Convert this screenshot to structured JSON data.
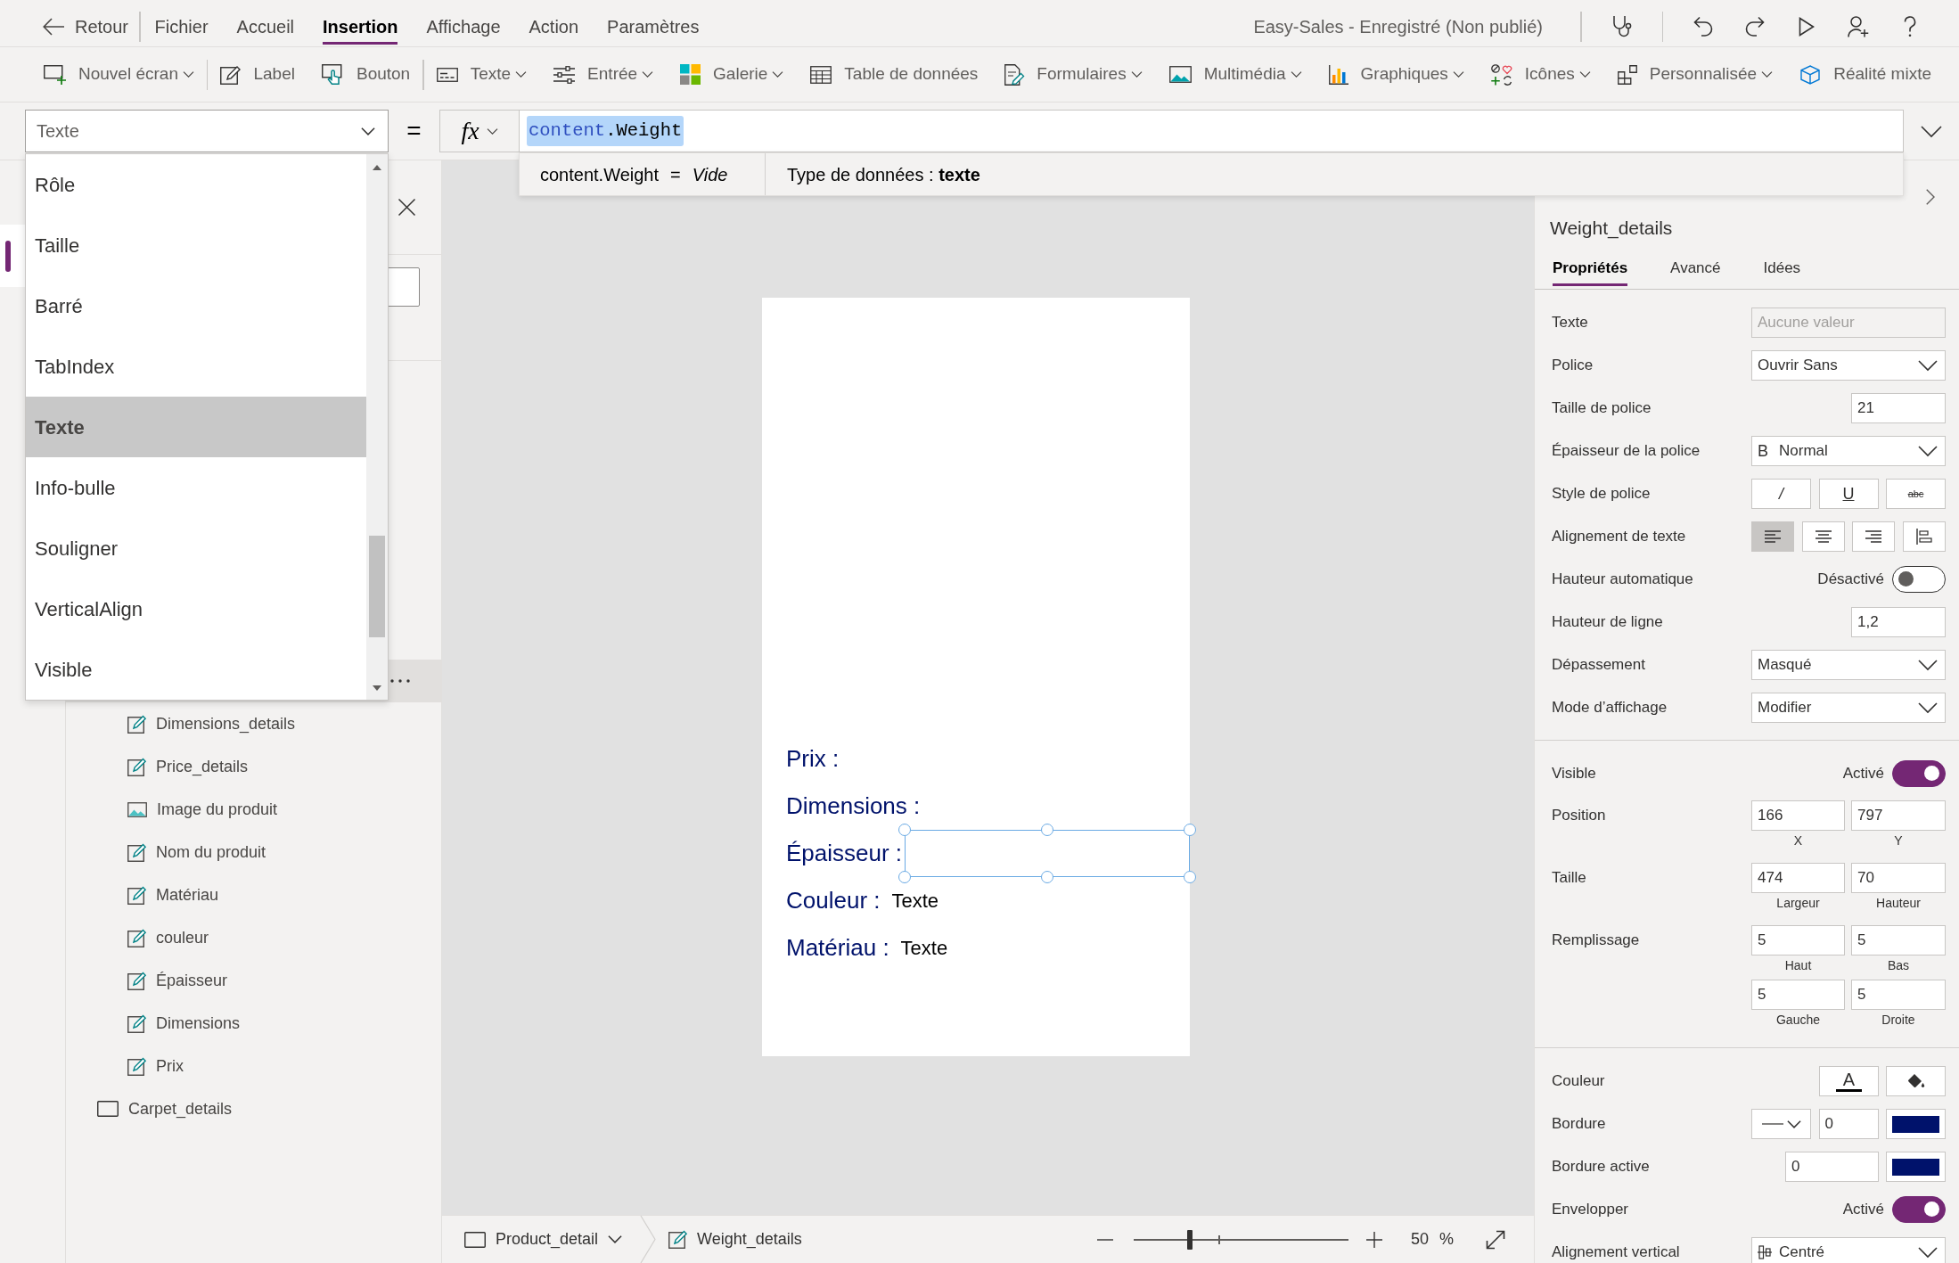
{
  "top_bar": {
    "back": "Retour",
    "menu": [
      {
        "label": "Fichier",
        "selected": false
      },
      {
        "label": "Accueil",
        "selected": false
      },
      {
        "label": "Insertion",
        "selected": true
      },
      {
        "label": "Affichage",
        "selected": false
      },
      {
        "label": "Action",
        "selected": false
      },
      {
        "label": "Paramètres",
        "selected": false
      }
    ],
    "app_status": "Easy-Sales - Enregistré (Non publié)",
    "action_groups": [
      [
        {
          "kind": "checker"
        }
      ],
      [
        {
          "kind": "undo"
        },
        {
          "kind": "redo"
        },
        {
          "kind": "preview"
        },
        {
          "kind": "share"
        },
        {
          "kind": "help"
        }
      ]
    ]
  },
  "ribbon": {
    "groups": [
      [
        {
          "kind": "new_screen",
          "label": "Nouvel écran",
          "dropdown": true
        }
      ],
      [
        {
          "kind": "label",
          "label": "Label",
          "dropdown": false
        },
        {
          "kind": "button",
          "label": "Bouton",
          "dropdown": false
        }
      ],
      [
        {
          "kind": "text",
          "label": "Texte",
          "dropdown": true
        },
        {
          "kind": "input",
          "label": "Entrée",
          "dropdown": true
        },
        {
          "kind": "gallery",
          "label": "Galerie",
          "dropdown": true
        },
        {
          "kind": "table",
          "label": "Table de données",
          "dropdown": false
        },
        {
          "kind": "forms",
          "label": "Formulaires",
          "dropdown": true
        },
        {
          "kind": "media",
          "label": "Multimédia",
          "dropdown": true
        },
        {
          "kind": "charts",
          "label": "Graphiques",
          "dropdown": true
        },
        {
          "kind": "icons",
          "label": "Icônes",
          "dropdown": true
        },
        {
          "kind": "custom",
          "label": "Personnalisée",
          "dropdown": true
        },
        {
          "kind": "mixed_reality",
          "label": "Réalité mixte",
          "dropdown": false
        }
      ]
    ]
  },
  "formula_bar": {
    "property": {
      "value": "Texte",
      "expanded": true,
      "options": [
        {
          "label": "Rôle",
          "selected": false
        },
        {
          "label": "Taille",
          "selected": false
        },
        {
          "label": "Barré",
          "selected": false
        },
        {
          "label": "TabIndex",
          "selected": false
        },
        {
          "label": "Texte",
          "selected": true
        },
        {
          "label": "Info-bulle",
          "selected": false
        },
        {
          "label": "Souligner",
          "selected": false
        },
        {
          "label": "VerticalAlign",
          "selected": false
        },
        {
          "label": "Visible",
          "selected": false
        }
      ]
    },
    "operator": "=",
    "fx": "fx",
    "tokens": [
      {
        "text": "content",
        "kind": "identifier"
      },
      {
        "text": ".Weight",
        "kind": "plain"
      }
    ],
    "selected": true,
    "hint": {
      "expression": "content.Weight",
      "operator": "=",
      "result": "Vide",
      "type_text": "Type de données : **texte**"
    }
  },
  "left_rail": {
    "items": [
      {
        "selected": true
      }
    ]
  },
  "tree": {
    "items": [
      {
        "children": [
          {
            "selected": true
          },
          {
            "label": "Dimensions_details",
            "kind": "label",
            "selected": false
          },
          {
            "label": "Price_details",
            "kind": "label",
            "selected": false
          },
          {
            "label": "Image du produit",
            "kind": "image",
            "selected": false
          },
          {
            "label": "Nom du produit",
            "kind": "label",
            "selected": false
          },
          {
            "label": "Matériau",
            "kind": "label",
            "selected": false
          },
          {
            "label": "couleur",
            "kind": "label",
            "selected": false
          },
          {
            "label": "Épaisseur",
            "kind": "label",
            "selected": false
          },
          {
            "label": "Dimensions",
            "kind": "label",
            "selected": false
          },
          {
            "label": "Prix",
            "kind": "label",
            "selected": false
          }
        ]
      },
      {
        "label": "Carpet_details",
        "kind": "container",
        "selected": false
      }
    ]
  },
  "canvas": {
    "rows": [
      {
        "label": "Prix :",
        "selected": false
      },
      {
        "label": "Dimensions :",
        "selected": false
      },
      {
        "label": "Épaisseur :",
        "selected": true
      },
      {
        "label": "Couleur :",
        "value": "Texte",
        "selected": false
      },
      {
        "label": "Matériau :",
        "value": "Texte",
        "selected": false
      }
    ]
  },
  "status_bar": {
    "screen": "Product_detail",
    "control": "Weight_details",
    "zoom": {
      "level": 0.26,
      "value": "50",
      "unit": "%"
    }
  },
  "properties_panel": {
    "control_name": "Weight_details",
    "tabs": [
      {
        "label": "Propriétés",
        "selected": true
      },
      {
        "label": "Avancé",
        "selected": false
      },
      {
        "label": "Idées",
        "selected": false
      }
    ],
    "sections": [
      {
        "rows": [
          {
            "label": "Texte",
            "kind": "text",
            "placeholder": "Aucune valeur"
          },
          {
            "label": "Police",
            "kind": "dropdown",
            "value": "Ouvrir Sans"
          },
          {
            "label": "Taille de police",
            "kind": "number",
            "value": "21"
          },
          {
            "label": "Épaisseur de la police",
            "kind": "dropdown",
            "glyph": "B",
            "value": "Normal"
          },
          {
            "label": "Style de police",
            "kind": "buttons",
            "buttons": [
              {
                "kind": "italic",
                "text": "/",
                "selected": false
              },
              {
                "kind": "underline",
                "text": "U",
                "selected": false
              },
              {
                "kind": "strikethrough",
                "text": "abc",
                "selected": false
              }
            ]
          },
          {
            "label": "Alignement de texte",
            "kind": "buttons",
            "buttons": [
              {
                "kind": "align_left",
                "selected": true
              },
              {
                "kind": "align_center",
                "selected": false
              },
              {
                "kind": "align_right",
                "selected": false
              },
              {
                "kind": "justify",
                "selected": false
              }
            ]
          },
          {
            "label": "Hauteur automatique",
            "kind": "toggle",
            "status": "Désactivé",
            "on": false
          },
          {
            "label": "Hauteur de ligne",
            "kind": "number",
            "value": "1,2"
          },
          {
            "label": "Dépassement",
            "kind": "dropdown",
            "value": "Masqué"
          },
          {
            "label": "Mode d’affichage",
            "kind": "dropdown",
            "value": "Modifier"
          }
        ]
      },
      {
        "rows": [
          {
            "label": "Visible",
            "kind": "toggle",
            "status": "Activé",
            "on": true
          },
          {
            "label": "Position",
            "kind": "pair",
            "fields": [
              {
                "value": "166",
                "caption": "X"
              },
              {
                "value": "797",
                "caption": "Y"
              }
            ]
          },
          {
            "label": "Taille",
            "kind": "pair",
            "fields": [
              {
                "value": "474",
                "caption": "Largeur"
              },
              {
                "value": "70",
                "caption": "Hauteur"
              }
            ]
          },
          {
            "label": "Remplissage",
            "kind": "pair",
            "fields": [
              {
                "value": "5",
                "caption": "Haut"
              },
              {
                "value": "5",
                "caption": "Bas"
              },
              {
                "value": "5",
                "caption": "Gauche"
              },
              {
                "value": "5",
                "caption": "Droite"
              }
            ]
          }
        ]
      },
      {
        "rows": [
          {
            "label": "Couleur",
            "kind": "buttons",
            "buttons": [
              {
                "kind": "text_color",
                "text": "A"
              },
              {
                "kind": "fill_color"
              }
            ]
          },
          {
            "label": "Bordure",
            "kind": "border",
            "value": "0",
            "color": "#00126b"
          },
          {
            "label": "Bordure active",
            "kind": "color_value",
            "value": "0",
            "color": "#00126b"
          },
          {
            "label": "Envelopper",
            "kind": "toggle",
            "status": "Activé",
            "on": true
          },
          {
            "label": "Alignement vertical",
            "kind": "align_dropdown",
            "value": "Centré"
          }
        ]
      }
    ]
  }
}
